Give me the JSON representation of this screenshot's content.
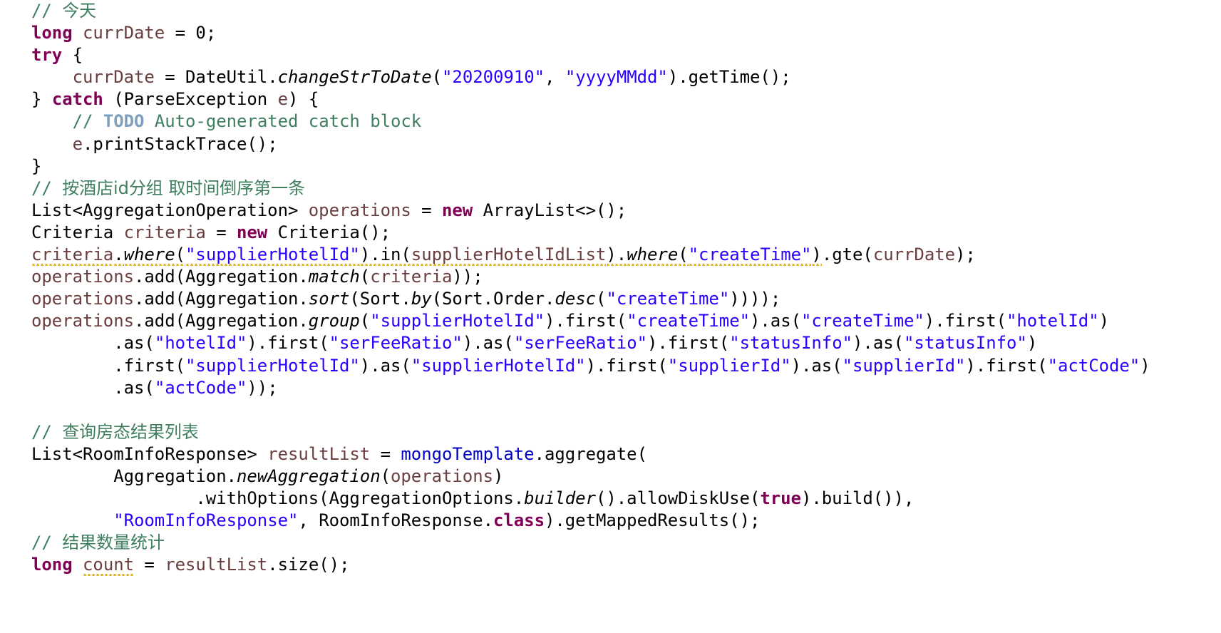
{
  "editor": {
    "language": "Java",
    "background": "#ffffff",
    "font_size_px": 24,
    "line_height_px": 31,
    "colors": {
      "plain": "#000000",
      "keyword": "#7f0055",
      "string": "#2a00ff",
      "comment": "#3f7f5f",
      "comment_task": "#7f9fbf",
      "local_variable": "#6a3e3e",
      "field": "#0000c0",
      "warning_squiggle": "#d6a400"
    }
  },
  "code": {
    "lines": [
      {
        "id": 1,
        "indent": 0,
        "text": "// 今天",
        "tokens": [
          {
            "t": "// ",
            "c": "cmt"
          },
          {
            "t": "今天",
            "c": "cmt cjk"
          }
        ]
      },
      {
        "id": 2,
        "indent": 0,
        "text": "long currDate = 0;",
        "tokens": [
          {
            "t": "long",
            "c": "kw"
          },
          {
            "t": " ",
            "c": "plain"
          },
          {
            "t": "currDate",
            "c": "local"
          },
          {
            "t": " = ",
            "c": "plain"
          },
          {
            "t": "0",
            "c": "plain"
          },
          {
            "t": ";",
            "c": "plain"
          }
        ]
      },
      {
        "id": 3,
        "indent": 0,
        "text": "try {",
        "tokens": [
          {
            "t": "try",
            "c": "kw"
          },
          {
            "t": " {",
            "c": "plain"
          }
        ]
      },
      {
        "id": 4,
        "indent": 1,
        "text": "currDate = DateUtil.changeStrToDate(\"20200910\", \"yyyyMMdd\").getTime();",
        "tokens": [
          {
            "t": "    ",
            "c": "plain"
          },
          {
            "t": "currDate",
            "c": "local"
          },
          {
            "t": " = DateUtil.",
            "c": "plain"
          },
          {
            "t": "changeStrToDate",
            "c": "static"
          },
          {
            "t": "(",
            "c": "plain"
          },
          {
            "t": "\"20200910\"",
            "c": "str"
          },
          {
            "t": ", ",
            "c": "plain"
          },
          {
            "t": "\"yyyyMMdd\"",
            "c": "str"
          },
          {
            "t": ").getTime();",
            "c": "plain"
          }
        ]
      },
      {
        "id": 5,
        "indent": 0,
        "text": "} catch (ParseException e) {",
        "tokens": [
          {
            "t": "} ",
            "c": "plain"
          },
          {
            "t": "catch",
            "c": "kw"
          },
          {
            "t": " (ParseException ",
            "c": "plain"
          },
          {
            "t": "e",
            "c": "local"
          },
          {
            "t": ") {",
            "c": "plain"
          }
        ]
      },
      {
        "id": 6,
        "indent": 1,
        "text": "// TODO Auto-generated catch block",
        "tokens": [
          {
            "t": "    ",
            "c": "plain"
          },
          {
            "t": "// ",
            "c": "cmt"
          },
          {
            "t": "TODO",
            "c": "cmt-task"
          },
          {
            "t": " Auto-generated catch block",
            "c": "cmt"
          }
        ]
      },
      {
        "id": 7,
        "indent": 1,
        "text": "e.printStackTrace();",
        "tokens": [
          {
            "t": "    ",
            "c": "plain"
          },
          {
            "t": "e",
            "c": "local"
          },
          {
            "t": ".printStackTrace();",
            "c": "plain"
          }
        ]
      },
      {
        "id": 8,
        "indent": 0,
        "text": "}",
        "tokens": [
          {
            "t": "}",
            "c": "plain"
          }
        ]
      },
      {
        "id": 9,
        "indent": 0,
        "text": "// 按酒店id分组 取时间倒序第一条",
        "tokens": [
          {
            "t": "// ",
            "c": "cmt"
          },
          {
            "t": "按酒店id分组 取时间倒序第一条",
            "c": "cmt cjk"
          }
        ]
      },
      {
        "id": 10,
        "indent": 0,
        "text": "List<AggregationOperation> operations = new ArrayList<>();",
        "tokens": [
          {
            "t": "List<AggregationOperation> ",
            "c": "plain"
          },
          {
            "t": "operations",
            "c": "local"
          },
          {
            "t": " = ",
            "c": "plain"
          },
          {
            "t": "new",
            "c": "kw"
          },
          {
            "t": " ArrayList<>();",
            "c": "plain"
          }
        ]
      },
      {
        "id": 11,
        "indent": 0,
        "text": "Criteria criteria = new Criteria();",
        "tokens": [
          {
            "t": "Criteria ",
            "c": "plain"
          },
          {
            "t": "criteria",
            "c": "local"
          },
          {
            "t": " = ",
            "c": "plain"
          },
          {
            "t": "new",
            "c": "kw"
          },
          {
            "t": " Criteria();",
            "c": "plain"
          }
        ]
      },
      {
        "id": 12,
        "indent": 0,
        "text": "criteria.where(\"supplierHotelId\").in(supplierHotelIdList).where(\"createTime\").gte(currDate);",
        "warning": true,
        "tokens": [
          {
            "t": "criteria",
            "c": "local",
            "w": true
          },
          {
            "t": ".",
            "c": "plain",
            "w": true
          },
          {
            "t": "where",
            "c": "static",
            "w": true
          },
          {
            "t": "(",
            "c": "plain",
            "w": true
          },
          {
            "t": "\"supplierHotelId\"",
            "c": "str",
            "w": true
          },
          {
            "t": ").in(",
            "c": "plain",
            "w": true
          },
          {
            "t": "supplierHotelIdList",
            "c": "local",
            "w": true
          },
          {
            "t": ").",
            "c": "plain",
            "w": true
          },
          {
            "t": "where",
            "c": "static",
            "w": true
          },
          {
            "t": "(",
            "c": "plain",
            "w": true
          },
          {
            "t": "\"createTime\"",
            "c": "str",
            "w": true
          },
          {
            "t": ")",
            "c": "plain",
            "w": true
          },
          {
            "t": ".gte(",
            "c": "plain"
          },
          {
            "t": "currDate",
            "c": "local"
          },
          {
            "t": ");",
            "c": "plain"
          }
        ]
      },
      {
        "id": 13,
        "indent": 0,
        "text": "operations.add(Aggregation.match(criteria));",
        "tokens": [
          {
            "t": "operations",
            "c": "local"
          },
          {
            "t": ".add(Aggregation.",
            "c": "plain"
          },
          {
            "t": "match",
            "c": "static"
          },
          {
            "t": "(",
            "c": "plain"
          },
          {
            "t": "criteria",
            "c": "local"
          },
          {
            "t": "));",
            "c": "plain"
          }
        ]
      },
      {
        "id": 14,
        "indent": 0,
        "text": "operations.add(Aggregation.sort(Sort.by(Sort.Order.desc(\"createTime\"))));",
        "tokens": [
          {
            "t": "operations",
            "c": "local"
          },
          {
            "t": ".add(Aggregation.",
            "c": "plain"
          },
          {
            "t": "sort",
            "c": "static"
          },
          {
            "t": "(Sort.",
            "c": "plain"
          },
          {
            "t": "by",
            "c": "static"
          },
          {
            "t": "(Sort.Order.",
            "c": "plain"
          },
          {
            "t": "desc",
            "c": "static"
          },
          {
            "t": "(",
            "c": "plain"
          },
          {
            "t": "\"createTime\"",
            "c": "str"
          },
          {
            "t": "))));",
            "c": "plain"
          }
        ]
      },
      {
        "id": 15,
        "indent": 0,
        "text": "operations.add(Aggregation.group(\"supplierHotelId\").first(\"createTime\").as(\"createTime\").first(\"hotelId\")",
        "tokens": [
          {
            "t": "operations",
            "c": "local"
          },
          {
            "t": ".add(Aggregation.",
            "c": "plain"
          },
          {
            "t": "group",
            "c": "static"
          },
          {
            "t": "(",
            "c": "plain"
          },
          {
            "t": "\"supplierHotelId\"",
            "c": "str"
          },
          {
            "t": ").first(",
            "c": "plain"
          },
          {
            "t": "\"createTime\"",
            "c": "str"
          },
          {
            "t": ").as(",
            "c": "plain"
          },
          {
            "t": "\"createTime\"",
            "c": "str"
          },
          {
            "t": ").first(",
            "c": "plain"
          },
          {
            "t": "\"hotelId\"",
            "c": "str"
          },
          {
            "t": ")",
            "c": "plain"
          }
        ]
      },
      {
        "id": 16,
        "indent": 2,
        "text": ".as(\"hotelId\").first(\"serFeeRatio\").as(\"serFeeRatio\").first(\"statusInfo\").as(\"statusInfo\")",
        "tokens": [
          {
            "t": "        ",
            "c": "plain"
          },
          {
            "t": ".as(",
            "c": "plain"
          },
          {
            "t": "\"hotelId\"",
            "c": "str"
          },
          {
            "t": ").first(",
            "c": "plain"
          },
          {
            "t": "\"serFeeRatio\"",
            "c": "str"
          },
          {
            "t": ").as(",
            "c": "plain"
          },
          {
            "t": "\"serFeeRatio\"",
            "c": "str"
          },
          {
            "t": ").first(",
            "c": "plain"
          },
          {
            "t": "\"statusInfo\"",
            "c": "str"
          },
          {
            "t": ").as(",
            "c": "plain"
          },
          {
            "t": "\"statusInfo\"",
            "c": "str"
          },
          {
            "t": ")",
            "c": "plain"
          }
        ]
      },
      {
        "id": 17,
        "indent": 2,
        "text": ".first(\"supplierHotelId\").as(\"supplierHotelId\").first(\"supplierId\").as(\"supplierId\").first(\"actCode\")",
        "tokens": [
          {
            "t": "        ",
            "c": "plain"
          },
          {
            "t": ".first(",
            "c": "plain"
          },
          {
            "t": "\"supplierHotelId\"",
            "c": "str"
          },
          {
            "t": ").as(",
            "c": "plain"
          },
          {
            "t": "\"supplierHotelId\"",
            "c": "str"
          },
          {
            "t": ").first(",
            "c": "plain"
          },
          {
            "t": "\"supplierId\"",
            "c": "str"
          },
          {
            "t": ").as(",
            "c": "plain"
          },
          {
            "t": "\"supplierId\"",
            "c": "str"
          },
          {
            "t": ").first(",
            "c": "plain"
          },
          {
            "t": "\"actCode\"",
            "c": "str"
          },
          {
            "t": ")",
            "c": "plain"
          }
        ]
      },
      {
        "id": 18,
        "indent": 2,
        "text": ".as(\"actCode\"));",
        "tokens": [
          {
            "t": "        ",
            "c": "plain"
          },
          {
            "t": ".as(",
            "c": "plain"
          },
          {
            "t": "\"actCode\"",
            "c": "str"
          },
          {
            "t": "));",
            "c": "plain"
          }
        ]
      },
      {
        "id": 19,
        "indent": 0,
        "text": "",
        "tokens": [
          {
            "t": " ",
            "c": "plain"
          }
        ]
      },
      {
        "id": 20,
        "indent": 0,
        "text": "// 查询房态结果列表",
        "tokens": [
          {
            "t": "// ",
            "c": "cmt"
          },
          {
            "t": "查询房态结果列表",
            "c": "cmt cjk"
          }
        ]
      },
      {
        "id": 21,
        "indent": 0,
        "text": "List<RoomInfoResponse> resultList = mongoTemplate.aggregate(",
        "tokens": [
          {
            "t": "List<RoomInfoResponse> ",
            "c": "plain"
          },
          {
            "t": "resultList",
            "c": "local"
          },
          {
            "t": " = ",
            "c": "plain"
          },
          {
            "t": "mongoTemplate",
            "c": "field"
          },
          {
            "t": ".aggregate(",
            "c": "plain"
          }
        ]
      },
      {
        "id": 22,
        "indent": 2,
        "text": "Aggregation.newAggregation(operations)",
        "tokens": [
          {
            "t": "        ",
            "c": "plain"
          },
          {
            "t": "Aggregation.",
            "c": "plain"
          },
          {
            "t": "newAggregation",
            "c": "static"
          },
          {
            "t": "(",
            "c": "plain"
          },
          {
            "t": "operations",
            "c": "local"
          },
          {
            "t": ")",
            "c": "plain"
          }
        ]
      },
      {
        "id": 23,
        "indent": 4,
        "text": ".withOptions(AggregationOptions.builder().allowDiskUse(true).build()),",
        "tokens": [
          {
            "t": "                ",
            "c": "plain"
          },
          {
            "t": ".withOptions(AggregationOptions.",
            "c": "plain"
          },
          {
            "t": "builder",
            "c": "static"
          },
          {
            "t": "().allowDiskUse(",
            "c": "plain"
          },
          {
            "t": "true",
            "c": "kw"
          },
          {
            "t": ").build()),",
            "c": "plain"
          }
        ]
      },
      {
        "id": 24,
        "indent": 2,
        "text": "\"RoomInfoResponse\", RoomInfoResponse.class).getMappedResults();",
        "tokens": [
          {
            "t": "        ",
            "c": "plain"
          },
          {
            "t": "\"RoomInfoResponse\"",
            "c": "str"
          },
          {
            "t": ", RoomInfoResponse.",
            "c": "plain"
          },
          {
            "t": "class",
            "c": "kw"
          },
          {
            "t": ").getMappedResults();",
            "c": "plain"
          }
        ]
      },
      {
        "id": 25,
        "indent": 0,
        "text": "// 结果数量统计",
        "tokens": [
          {
            "t": "// ",
            "c": "cmt"
          },
          {
            "t": "结果数量统计",
            "c": "cmt cjk"
          }
        ]
      },
      {
        "id": 26,
        "indent": 0,
        "text": "long count = resultList.size();",
        "tokens": [
          {
            "t": "long",
            "c": "kw"
          },
          {
            "t": " ",
            "c": "plain"
          },
          {
            "t": "count",
            "c": "local",
            "w": true
          },
          {
            "t": " = ",
            "c": "plain"
          },
          {
            "t": "resultList",
            "c": "local"
          },
          {
            "t": ".size();",
            "c": "plain"
          }
        ]
      }
    ]
  }
}
